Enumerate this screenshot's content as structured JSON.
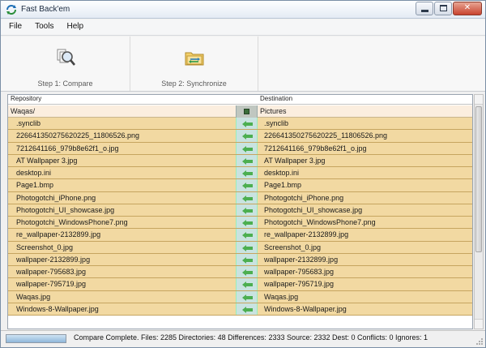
{
  "window": {
    "title": "Fast Back'em",
    "controls": {
      "minimize": "minimize",
      "maximize": "maximize",
      "close": "close"
    }
  },
  "menu": {
    "items": [
      {
        "label": "File"
      },
      {
        "label": "Tools"
      },
      {
        "label": "Help"
      }
    ]
  },
  "toolbar": {
    "compare_label": "Step 1: Compare",
    "compare_icon": "magnifier-documents-icon",
    "sync_label": "Step 2: Synchronize",
    "sync_icon": "folder-sync-icon"
  },
  "list": {
    "repository_header": "Repository",
    "destination_header": "Destination",
    "repository_root": "Waqas/",
    "destination_root": "Pictures",
    "colors": {
      "row_background": "#f2d9a2",
      "arrow_column": "#c9e3e0",
      "arrow": "#4caf50"
    },
    "rows": [
      {
        "left": ".synclib",
        "right": ".synclib"
      },
      {
        "left": "226641350275620225_11806526.png",
        "right": "226641350275620225_11806526.png"
      },
      {
        "left": "7212641166_979b8e62f1_o.jpg",
        "right": "7212641166_979b8e62f1_o.jpg"
      },
      {
        "left": "AT Wallpaper 3.jpg",
        "right": "AT Wallpaper 3.jpg"
      },
      {
        "left": "desktop.ini",
        "right": "desktop.ini"
      },
      {
        "left": "Page1.bmp",
        "right": "Page1.bmp"
      },
      {
        "left": "Photogotchi_iPhone.png",
        "right": "Photogotchi_iPhone.png"
      },
      {
        "left": "Photogotchi_UI_showcase.jpg",
        "right": "Photogotchi_UI_showcase.jpg"
      },
      {
        "left": "Photogotchi_WindowsPhone7.png",
        "right": "Photogotchi_WindowsPhone7.png"
      },
      {
        "left": "re_wallpaper-2132899.jpg",
        "right": "re_wallpaper-2132899.jpg"
      },
      {
        "left": "Screenshot_0.jpg",
        "right": "Screenshot_0.jpg"
      },
      {
        "left": "wallpaper-2132899.jpg",
        "right": "wallpaper-2132899.jpg"
      },
      {
        "left": "wallpaper-795683.jpg",
        "right": "wallpaper-795683.jpg"
      },
      {
        "left": "wallpaper-795719.jpg",
        "right": "wallpaper-795719.jpg"
      },
      {
        "left": "Waqas.jpg",
        "right": "Waqas.jpg"
      },
      {
        "left": "Windows-8-Wallpaper.jpg",
        "right": "Windows-8-Wallpaper.jpg"
      }
    ]
  },
  "status": {
    "progress_percent": 100,
    "text": "Compare Complete. Files: 2285 Directories: 48 Differences: 2333 Source: 2332 Dest: 0 Conflicts: 0 Ignores: 1"
  }
}
